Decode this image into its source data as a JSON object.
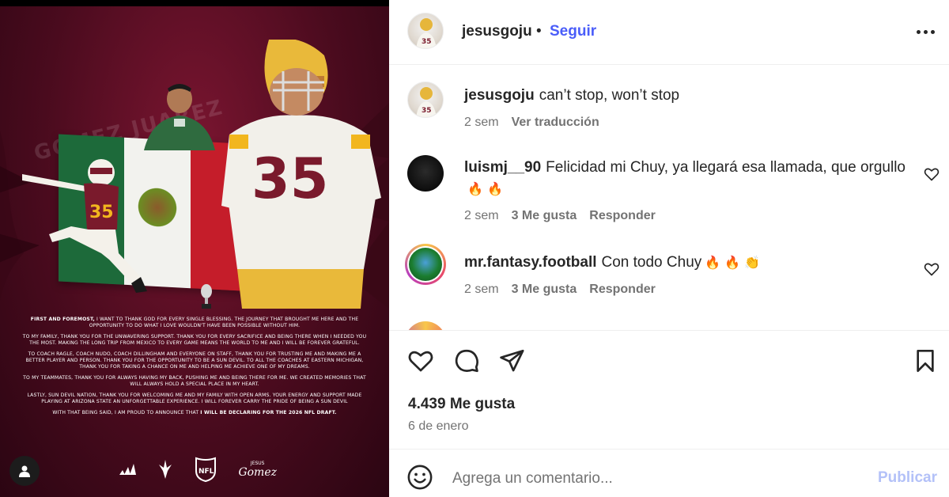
{
  "post_image": {
    "background_name": "GOMEZ JUAREZ",
    "big_jersey_number": "35",
    "small_jersey_number": "35",
    "statement": {
      "p1_bold": "FIRST AND FOREMOST,",
      "p1": " I WANT TO THANK GOD FOR EVERY SINGLE BLESSING. THE JOURNEY THAT BROUGHT ME HERE AND THE OPPORTUNITY TO DO WHAT I LOVE WOULDN'T HAVE BEEN POSSIBLE WITHOUT HIM.",
      "p2": "TO MY FAMILY, THANK YOU FOR THE UNWAVERING SUPPORT. THANK YOU FOR EVERY SACRIFICE AND BEING THERE WHEN I NEEDED YOU THE MOST. MAKING THE LONG TRIP FROM MEXICO TO EVERY GAME MEANS THE WORLD TO ME AND I WILL BE FOREVER GRATEFUL.",
      "p3": "TO COACH RAGLE, COACH NUDO, COACH DILLINGHAM AND EVERYONE ON STAFF, THANK YOU FOR TRUSTING ME AND MAKING ME A BETTER PLAYER AND PERSON. THANK YOU FOR THE OPPORTUNITY TO BE A SUN DEVIL. TO ALL THE COACHES AT EASTERN MICHIGAN, THANK YOU FOR TAKING A CHANCE ON ME AND HELPING ME ACHIEVE ONE OF MY DREAMS.",
      "p4": "TO MY TEAMMATES, THANK YOU FOR ALWAYS HAVING MY BACK, PUSHING ME AND BEING THERE FOR ME. WE CREATED MEMORIES THAT WILL ALWAYS HOLD A SPECIAL PLACE IN MY HEART.",
      "p5": "LASTLY, SUN DEVIL NATION, THANK YOU FOR WELCOMING ME AND MY FAMILY WITH OPEN ARMS. YOUR ENERGY AND SUPPORT MADE PLAYING AT ARIZONA STATE AN UNFORGETTABLE EXPERIENCE. I WILL FOREVER CARRY THE PRIDE OF BEING A SUN DEVIL",
      "p6": "WITH THAT BEING SAID, I AM PROUD TO ANNOUNCE THAT ",
      "p6_bold": "I WILL BE DECLARING FOR THE 2026 NFL DRAFT."
    },
    "logos": {
      "nfl": "NFL",
      "signature_top": "JESUS",
      "signature": "Gomez"
    }
  },
  "header": {
    "username": "jesusgoju",
    "separator": "•",
    "follow_label": "Seguir"
  },
  "caption": {
    "username": "jesusgoju",
    "text": "can’t stop, won’t stop",
    "time": "2 sem",
    "translate_label": "Ver traducción"
  },
  "comments": [
    {
      "username": "luismj__90",
      "text": "Felicidad mi Chuy, ya llegará esa llamada, que orgullo",
      "emojis": "🔥 🔥",
      "time": "2 sem",
      "likes": "3 Me gusta",
      "reply_label": "Responder"
    },
    {
      "username": "mr.fantasy.football",
      "text": "Con todo Chuy",
      "emojis": "🔥 🔥 👏",
      "time": "2 sem",
      "likes": "3 Me gusta",
      "reply_label": "Responder"
    }
  ],
  "icons": {
    "like": "heart-icon",
    "comment": "comment-icon",
    "share": "send-icon",
    "save": "bookmark-icon",
    "emoji": "emoji-icon",
    "more": "more-options-icon",
    "user_tag": "user-icon"
  },
  "stats": {
    "likes": "4.439 Me gusta",
    "date": "6 de enero"
  },
  "add_comment": {
    "placeholder": "Agrega un comentario...",
    "post_label": "Publicar"
  },
  "colors": {
    "accent": "#4a5df9",
    "post_disabled": "#b3c1f8",
    "maroon": "#6a1228",
    "gold": "#f2b61e"
  }
}
